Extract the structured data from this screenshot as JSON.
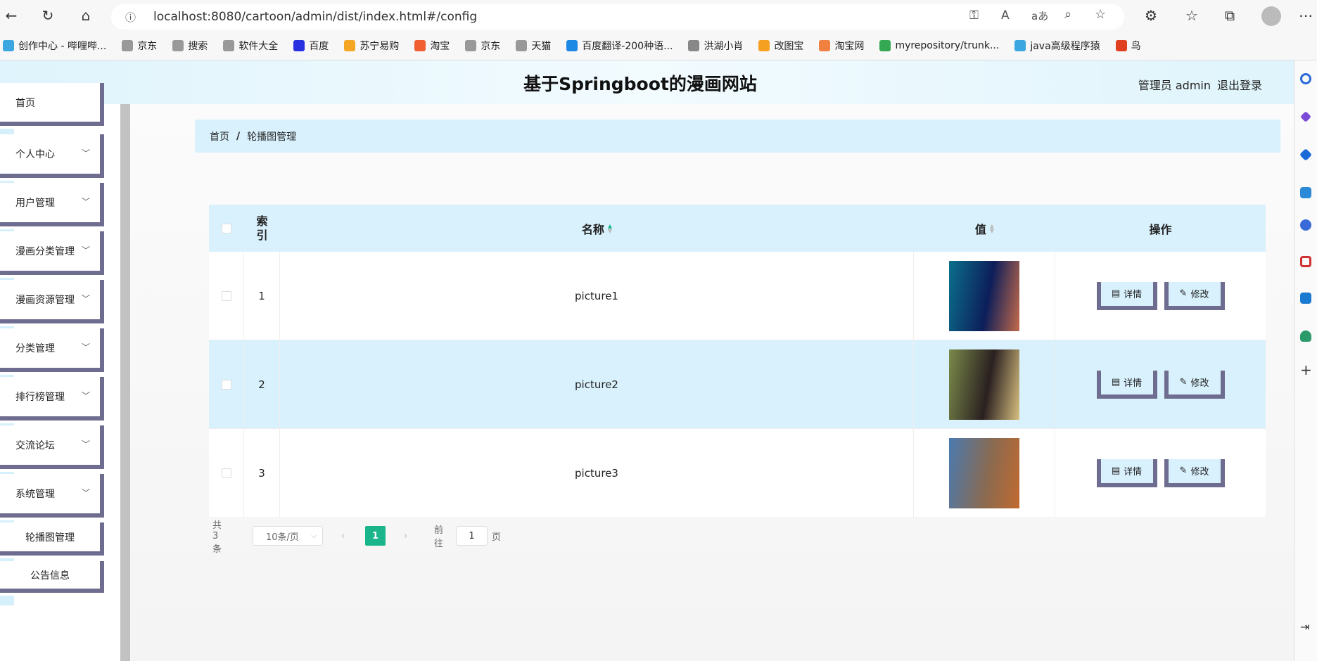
{
  "browser": {
    "url": "localhost:8080/cartoon/admin/dist/index.html#/config",
    "bookmarks": [
      "创作中心 - 哔哩哔...",
      "京东",
      "搜索",
      "软件大全",
      "百度",
      "苏宁易购",
      "淘宝",
      "京东",
      "天猫",
      "百度翻译-200种语...",
      "洪湖小肖",
      "改图宝",
      "淘宝网",
      "myrepository/trunk...",
      "java高级程序猿",
      "鸟"
    ],
    "bookmark_colors": [
      "#3ba6e0",
      "#999",
      "#999",
      "#999",
      "#2932e1",
      "#f5a623",
      "#f06030",
      "#999",
      "#999",
      "#1e88e5",
      "#888",
      "#f5a020",
      "#f08040",
      "#34a853",
      "#3ba6e0",
      "#e04020"
    ]
  },
  "header": {
    "title": "基于Springboot的漫画网站",
    "admin": "管理员 admin",
    "logout": "退出登录"
  },
  "sidebar": {
    "items": [
      {
        "label": "首页",
        "chevron": false
      },
      {
        "label": "个人中心",
        "chevron": true
      },
      {
        "label": "用户管理",
        "chevron": true
      },
      {
        "label": "漫画分类管理",
        "chevron": true
      },
      {
        "label": "漫画资源管理",
        "chevron": true
      },
      {
        "label": "分类管理",
        "chevron": true
      },
      {
        "label": "排行榜管理",
        "chevron": true
      },
      {
        "label": "交流论坛",
        "chevron": true
      },
      {
        "label": "系统管理",
        "chevron": true
      },
      {
        "label": "轮播图管理",
        "chevron": false
      },
      {
        "label": "公告信息",
        "chevron": false
      }
    ]
  },
  "breadcrumb": {
    "home": "首页",
    "sep": "/",
    "current": "轮播图管理"
  },
  "table": {
    "headers": {
      "index": "索引",
      "name": "名称",
      "value": "值",
      "actions": "操作"
    },
    "rows": [
      {
        "index": "1",
        "name": "picture1",
        "colors": [
          "#0b6f8c",
          "#0c1e5a",
          "#c46a4a"
        ]
      },
      {
        "index": "2",
        "name": "picture2",
        "colors": [
          "#7a8a4a",
          "#2a2020",
          "#d8c080"
        ]
      },
      {
        "index": "3",
        "name": "picture3",
        "colors": [
          "#4a7ab0",
          "#8a6a50",
          "#c06a30"
        ]
      }
    ],
    "detail_label": "详情",
    "edit_label": "修改"
  },
  "pagination": {
    "total": "共 3 条",
    "page_size": "10条/页",
    "current_page": "1",
    "goto_label": "前往",
    "goto_value": "1",
    "page_suffix": "页"
  },
  "colors": {
    "accent": "#1bb58c",
    "header_bg": "#d8f1fd",
    "border": "#6f6d8f"
  }
}
